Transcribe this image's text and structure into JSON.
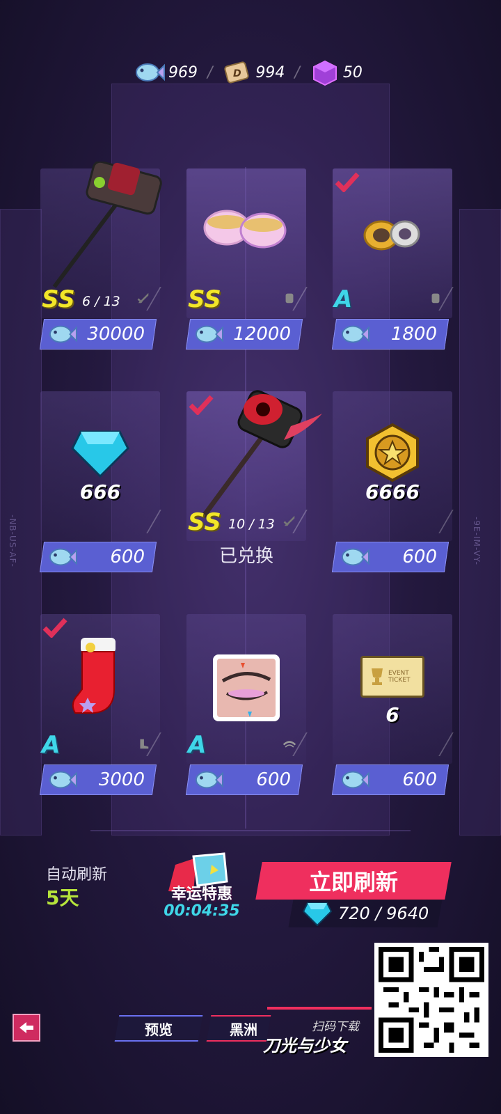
{
  "currencies": [
    {
      "icon": "fish-coin-icon",
      "value": "969"
    },
    {
      "icon": "d-ticket-icon",
      "value": "994"
    },
    {
      "icon": "purple-cube-icon",
      "value": "50"
    }
  ],
  "side_tags": {
    "left": "-NB-US-AF-",
    "right": "-9E-IM-VY-"
  },
  "items": [
    {
      "name": "weapon-hammer-ss",
      "grade": "SS",
      "progress": "6 / 13",
      "type_icon": "sword-icon",
      "price": "30000",
      "checked": false
    },
    {
      "name": "gold-bracelets-ss",
      "grade": "SS",
      "progress": "",
      "type_icon": "glove-icon",
      "price": "12000",
      "checked": false
    },
    {
      "name": "gold-rings-a",
      "grade": "A",
      "progress": "",
      "type_icon": "glove-icon",
      "price": "1800",
      "checked": true
    },
    {
      "name": "diamond",
      "qty": "666",
      "price": "600",
      "checked": false
    },
    {
      "name": "weapon-red-hammer-ss",
      "grade": "SS",
      "progress": "10 / 13",
      "type_icon": "sword-icon",
      "redeemed": "已兑换",
      "checked": true
    },
    {
      "name": "gold-coin",
      "qty": "6666",
      "price": "600",
      "checked": false
    },
    {
      "name": "christmas-sock-a",
      "grade": "A",
      "type_icon": "boot-icon",
      "price": "3000",
      "checked": true
    },
    {
      "name": "eye-makeup-a",
      "grade": "A",
      "type_icon": "eye-icon",
      "price": "600",
      "checked": false
    },
    {
      "name": "event-ticket",
      "qty": "6",
      "ticket_text": "EVENT TICKET",
      "price": "600",
      "checked": false
    }
  ],
  "auto_refresh": {
    "label": "自动刷新",
    "days": "5天"
  },
  "lucky_deal": {
    "title": "幸运特惠",
    "timer": "00:04:35"
  },
  "refresh": {
    "label": "立即刷新",
    "cost": "720 / 9640"
  },
  "nav": {
    "tab_preview": "预览",
    "tab_black": "黑洲"
  },
  "promo": {
    "scan": "扫码下载",
    "name": "刀光与少女"
  },
  "colors": {
    "accent_pink": "#ef2f5e",
    "price_blue": "#5a5fd2",
    "grade_ss": "#f2e629",
    "grade_a": "#3fd6e8",
    "days_green": "#b6e43b"
  }
}
